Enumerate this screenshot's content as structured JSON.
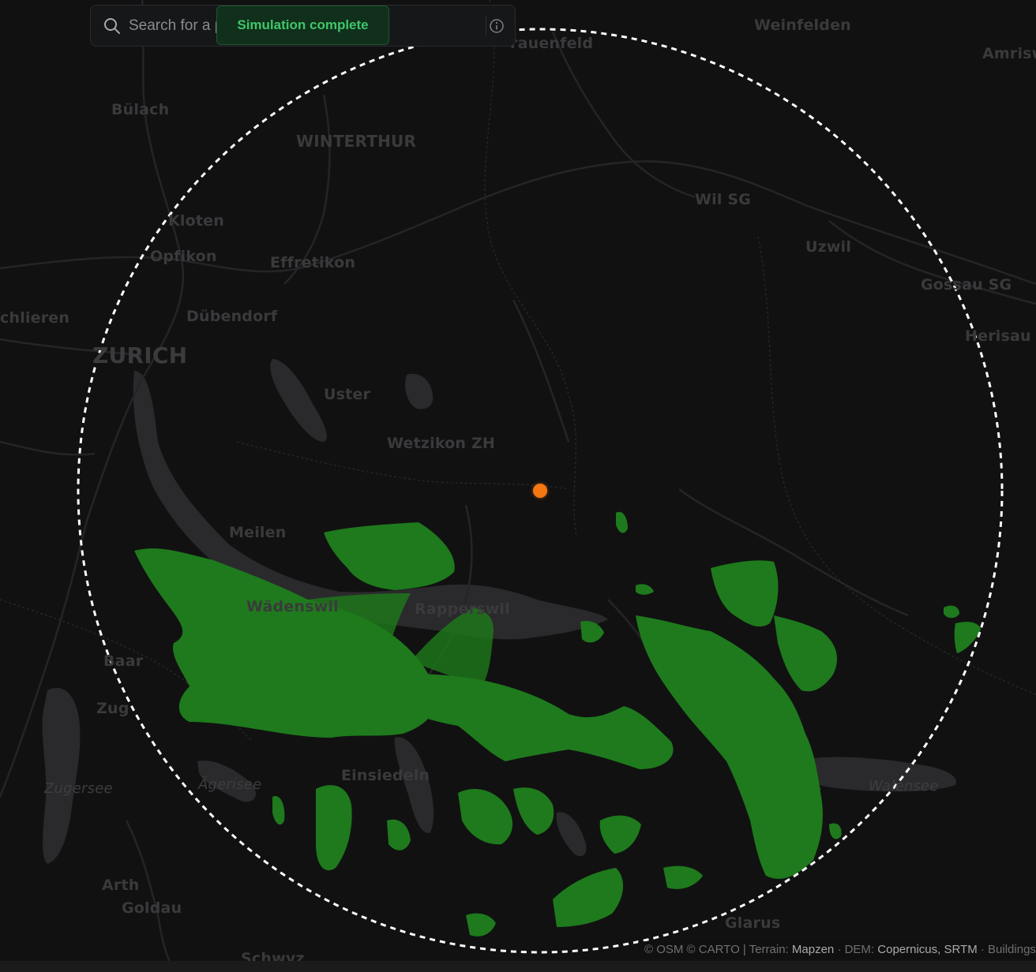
{
  "search": {
    "placeholder": "Search for a place..."
  },
  "toast": {
    "text": "Simulation complete"
  },
  "map": {
    "labels": {
      "frauenfeld": "rauenfeld",
      "weinfelden": "Weinfelden",
      "amriswil": "Amrisw",
      "bulach": "Bülach",
      "winterthur": "WINTERTHUR",
      "wil": "Wil SG",
      "kloten": "Kloten",
      "uzwil": "Uzwil",
      "opfikon": "Opfikon",
      "effretikon": "Effretikon",
      "gossau": "Gossau SG",
      "schlieren": "chlieren",
      "dubendorf": "Dübendorf",
      "herisau": "Herisau",
      "zurich": "ZURICH",
      "uster": "Uster",
      "wetzikon": "Wetzikon ZH",
      "meilen": "Meilen",
      "wadenswil": "Wädenswil",
      "rapperswil": "Rapperswil",
      "baar": "Baar",
      "zug": "Zug",
      "einsiedeln": "Einsiedeln",
      "zugersee": "Zugersee",
      "agerisee": "Ägerisee",
      "walensee": "Walensee",
      "arth": "Arth",
      "goldau": "Goldau",
      "glarus": "Glarus",
      "schwyz": "Schwyz"
    },
    "coverage_color": "#1e7a1c",
    "marker_color": "#f47712",
    "range_circle_color": "#ffffff"
  },
  "attribution": {
    "prefix": "© OSM © CARTO | Terrain: ",
    "terrain": "Mapzen",
    "dem_label": " · DEM: ",
    "dem": "Copernicus, SRTM",
    "suffix": " · Buildings"
  }
}
